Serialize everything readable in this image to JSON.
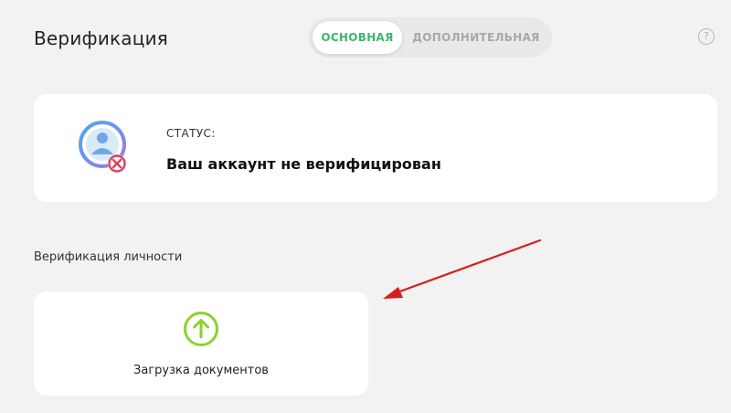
{
  "header": {
    "title": "Верификация",
    "help_glyph": "?"
  },
  "tabs": [
    {
      "label": "ОСНОВНАЯ",
      "active": true
    },
    {
      "label": "ДОПОЛНИТЕЛЬНАЯ",
      "active": false
    }
  ],
  "status": {
    "label": "СТАТУС:",
    "value": "Ваш аккаунт не верифицирован",
    "icon": "user-not-verified-icon"
  },
  "identity_section": {
    "title": "Верификация личности",
    "upload_label": "Загрузка документов",
    "upload_icon": "arrow-up-circle-icon"
  },
  "colors": {
    "accent_green": "#3db56b",
    "upload_icon": "#8dd12a",
    "error_red": "#e0405a",
    "annotation_red": "#d41f1f"
  }
}
